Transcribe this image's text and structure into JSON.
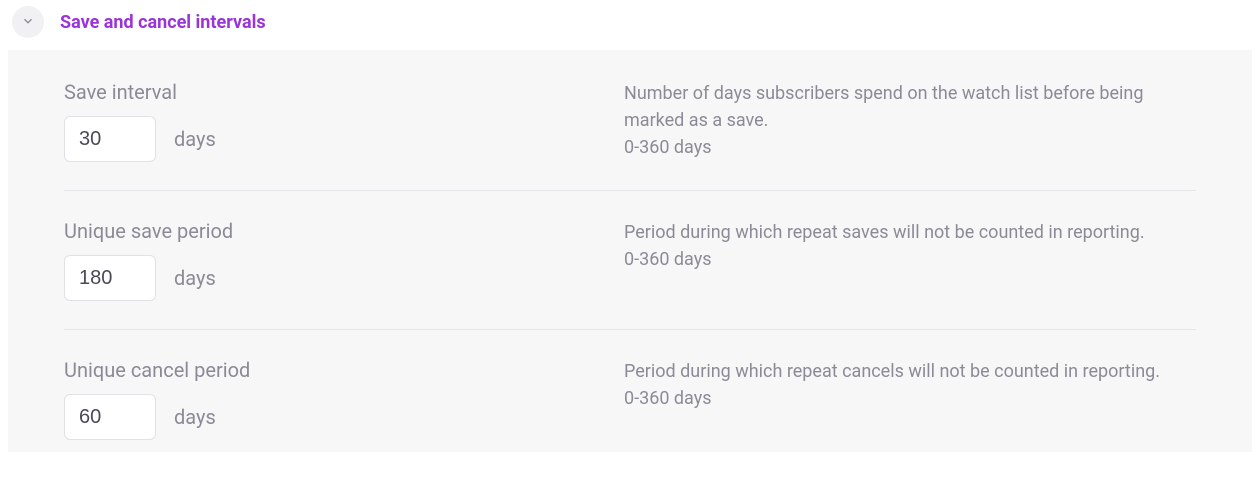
{
  "header": {
    "title": "Save and cancel intervals"
  },
  "fields": {
    "save_interval": {
      "label": "Save interval",
      "value": "30",
      "unit": "days",
      "description": "Number of days subscribers spend on the watch list before being marked as a save.",
      "range": "0-360 days"
    },
    "unique_save_period": {
      "label": "Unique save period",
      "value": "180",
      "unit": "days",
      "description": "Period during which repeat saves will not be counted in reporting.",
      "range": "0-360 days"
    },
    "unique_cancel_period": {
      "label": "Unique cancel period",
      "value": "60",
      "unit": "days",
      "description": "Period during which repeat cancels will not be counted in reporting.",
      "range": "0-360 days"
    }
  }
}
